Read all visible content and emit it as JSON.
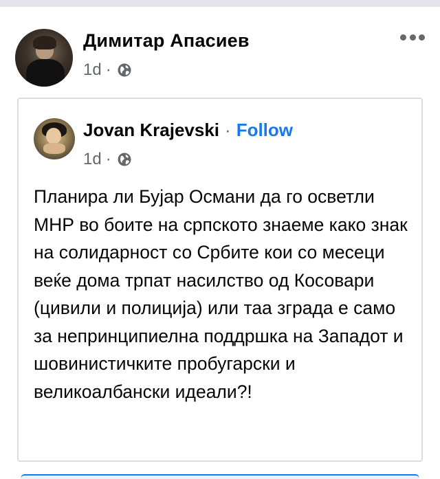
{
  "post": {
    "author": "Димитар Апасиев",
    "time": "1d",
    "separator": "·",
    "privacy_icon": "globe-icon",
    "menu_icon": "more-horizontal-icon"
  },
  "shared_post": {
    "author": "Jovan Krajevski",
    "separator": "·",
    "follow_label": "Follow",
    "time": "1d",
    "privacy_icon": "globe-icon",
    "text": "Планира ли Бујар Османи да го осветли МНР во боите на српското знаеме како знак на солидарност со Србите кои со месеци веќе дома трпат насилство од Косовари (цивили и полиција) или таа зграда е само за непринципиелна поддршка на Западот и шовинистичките пробугарски и великоалбански идеали?!"
  },
  "colors": {
    "link": "#1877f2",
    "secondary_text": "#65676b",
    "primary_text": "#050505",
    "border": "#dadde1"
  }
}
